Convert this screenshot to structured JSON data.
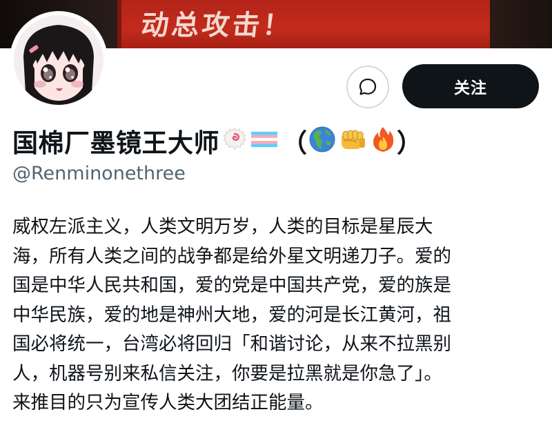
{
  "banner": {
    "text": "动总攻击！"
  },
  "actions": {
    "message_icon": "message-bubble-icon",
    "follow_label": "关注"
  },
  "profile": {
    "display_name": "国棉厂墨镜王大师",
    "name_emojis": [
      "narutomaki-icon",
      "transgender-flag-icon"
    ],
    "paren_open": "（",
    "paren_emojis": [
      "earth-americas-icon",
      "fist-icon",
      "fire-icon"
    ],
    "paren_close": "）",
    "handle": "@Renminonethree",
    "bio_lines": [
      "威权左派主义，人类文明万岁，人类的目标是星辰大",
      "海，所有人类之间的战争都是给外星文明递刀子。爱的",
      "国是中华人民共和国，爱的党是中国共产党，爱的族是",
      "中华民族，爱的地是神州大地，爱的河是长江黄河，祖",
      "国必将统一，台湾必将回归「和谐讨论，从来不拉黑别",
      "人，机器号别来私信关注，你要是拉黑就是你急了」。",
      "来推目的只为宣传人类大团结正能量。"
    ]
  },
  "colors": {
    "banner_red": "#c32b1c",
    "follow_bg": "#0f1419",
    "handle_gray": "#536471",
    "border_gray": "#cfd9de"
  }
}
